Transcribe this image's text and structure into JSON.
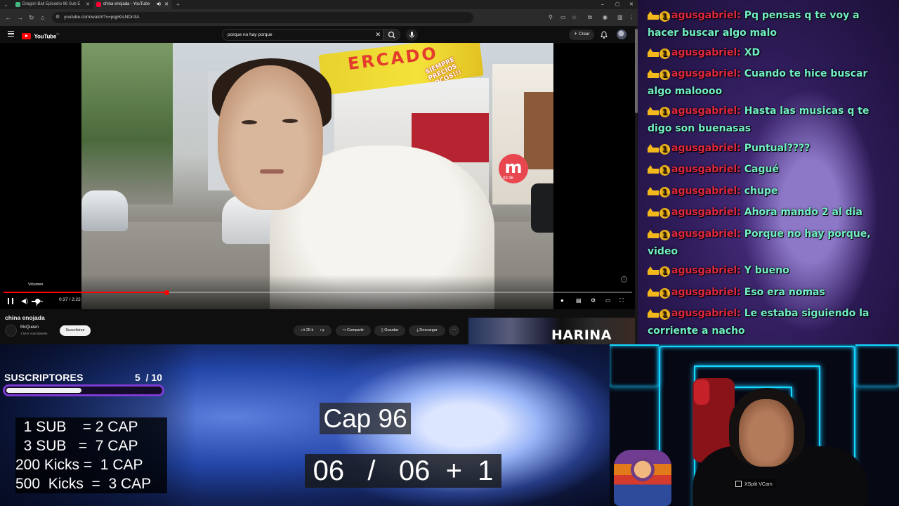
{
  "browser": {
    "tabs": [
      {
        "title": "Dragon Ball Episodio 96 Sub E",
        "active": false,
        "favicon_color": "#41b882"
      },
      {
        "title": "china enojada - YouTube",
        "active": true,
        "favicon_color": "#ff0033"
      }
    ],
    "new_tab_glyph": "+",
    "url": "youtube.com/watch?v=pqpKisNDn3A",
    "window_controls": [
      "–",
      "▢",
      "✕"
    ]
  },
  "youtube": {
    "logo_text": "YouTube",
    "logo_region": "CL",
    "search_query": "porque no hay porque",
    "create_label": "Crear",
    "video_title": "china enojada",
    "channel_name": "McQueen",
    "channel_subs": "1.54 K suscriptores",
    "subscribe_label": "Suscribirse",
    "likes": "25 k",
    "share_label": "Compartir",
    "save_label": "Guardar",
    "download_label": "Descargar",
    "thumb_text": "HARINA"
  },
  "player": {
    "volume_tooltip": "Volumen",
    "time_display": "0:37 / 2:22",
    "progress_fraction": 0.26,
    "volume_fraction": 0.4,
    "sign_text": "ERCADO",
    "sign_sub": "SIEMPRE PRECIOS LOCOS!!!",
    "badge_letter": "m",
    "badge_time": "03:36"
  },
  "chat": {
    "username": "agusgabriel",
    "badge_number": "1",
    "messages": [
      "Pq pensas q te voy a hacer buscar algo malo",
      "XD",
      "Cuando te hice buscar algo maloooo",
      "Hasta las musicas q te digo son buenasas",
      "Puntual????",
      "Cagué",
      "chupe",
      "Ahora mando 2 al dia",
      "Porque no hay porque, video",
      "Y bueno",
      "Eso era nomas",
      "Le estaba siguiendo la corriente a nacho"
    ]
  },
  "overlay": {
    "subs_label": "SUSCRIPTORES",
    "subs_current": "5",
    "subs_goal": "10",
    "subs_progress": 0.5,
    "rules": [
      "  1 SUB    = 2 CAP",
      "  3 SUB   =  7 CAP",
      "200 Kicks =  1 CAP",
      "500  Kicks  =  3 CAP"
    ],
    "cap_label": "Cap 96",
    "counter": "06   /   06  +  1"
  },
  "webcam": {
    "source_label": "XSplit VCam"
  },
  "colors": {
    "chat_user": "#e0283f",
    "chat_text": "#72f0c5",
    "subs_bar_border": "#7e3bd1",
    "yt_red": "#ff0000"
  }
}
